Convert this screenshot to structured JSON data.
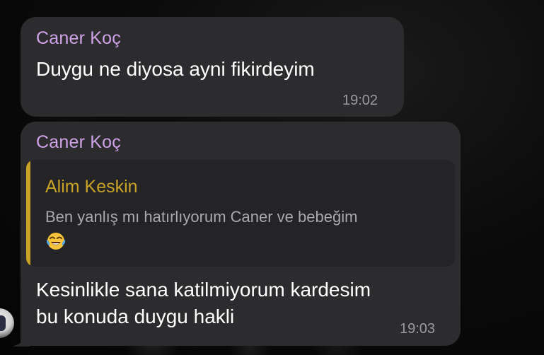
{
  "messages": [
    {
      "sender": "Caner Koç",
      "text": "Duygu ne diyosa ayni fikirdeyim",
      "time": "19:02"
    },
    {
      "sender": "Caner Koç",
      "reply": {
        "author": "Alim Keskin",
        "text": "Ben yanlış mı hatırlıyorum Caner ve bebeğim",
        "emoji_icon": "face-with-tears-of-joy-icon"
      },
      "text": "Kesinlikle sana katilmiyorum kardesim\nbu konuda duygu hakli",
      "time": "19:03"
    }
  ],
  "colors": {
    "bubble": "#2c2c2e",
    "sender_name": "#cfa2e8",
    "reply_accent": "#c9a227",
    "timestamp": "#9a9a9e"
  }
}
